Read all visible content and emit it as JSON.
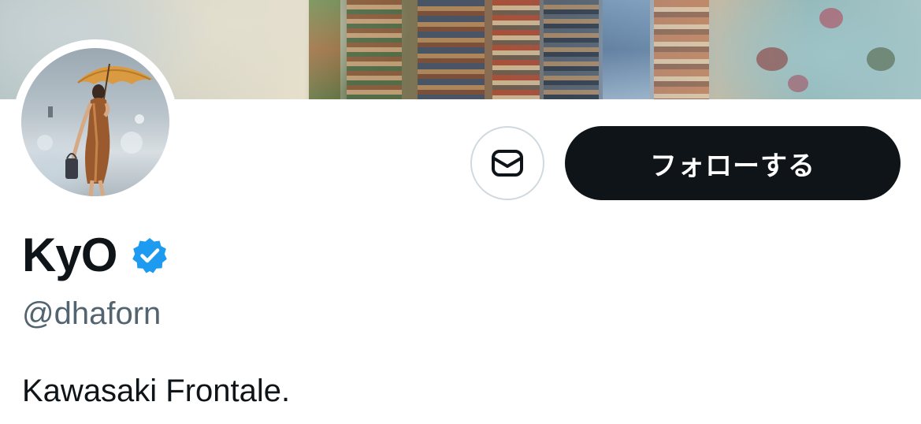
{
  "profile": {
    "display_name": "KyO",
    "handle": "@dhaforn",
    "bio": "Kawasaki Frontale.",
    "verified": true,
    "verified_icon": "verified-badge-icon"
  },
  "actions": {
    "message_icon": "envelope-icon",
    "follow_label": "フォローする"
  },
  "colors": {
    "text_primary": "#0f1419",
    "text_secondary": "#536471",
    "verified_blue": "#1d9bf0",
    "follow_bg": "#0f1419",
    "border": "#cfd9de"
  }
}
